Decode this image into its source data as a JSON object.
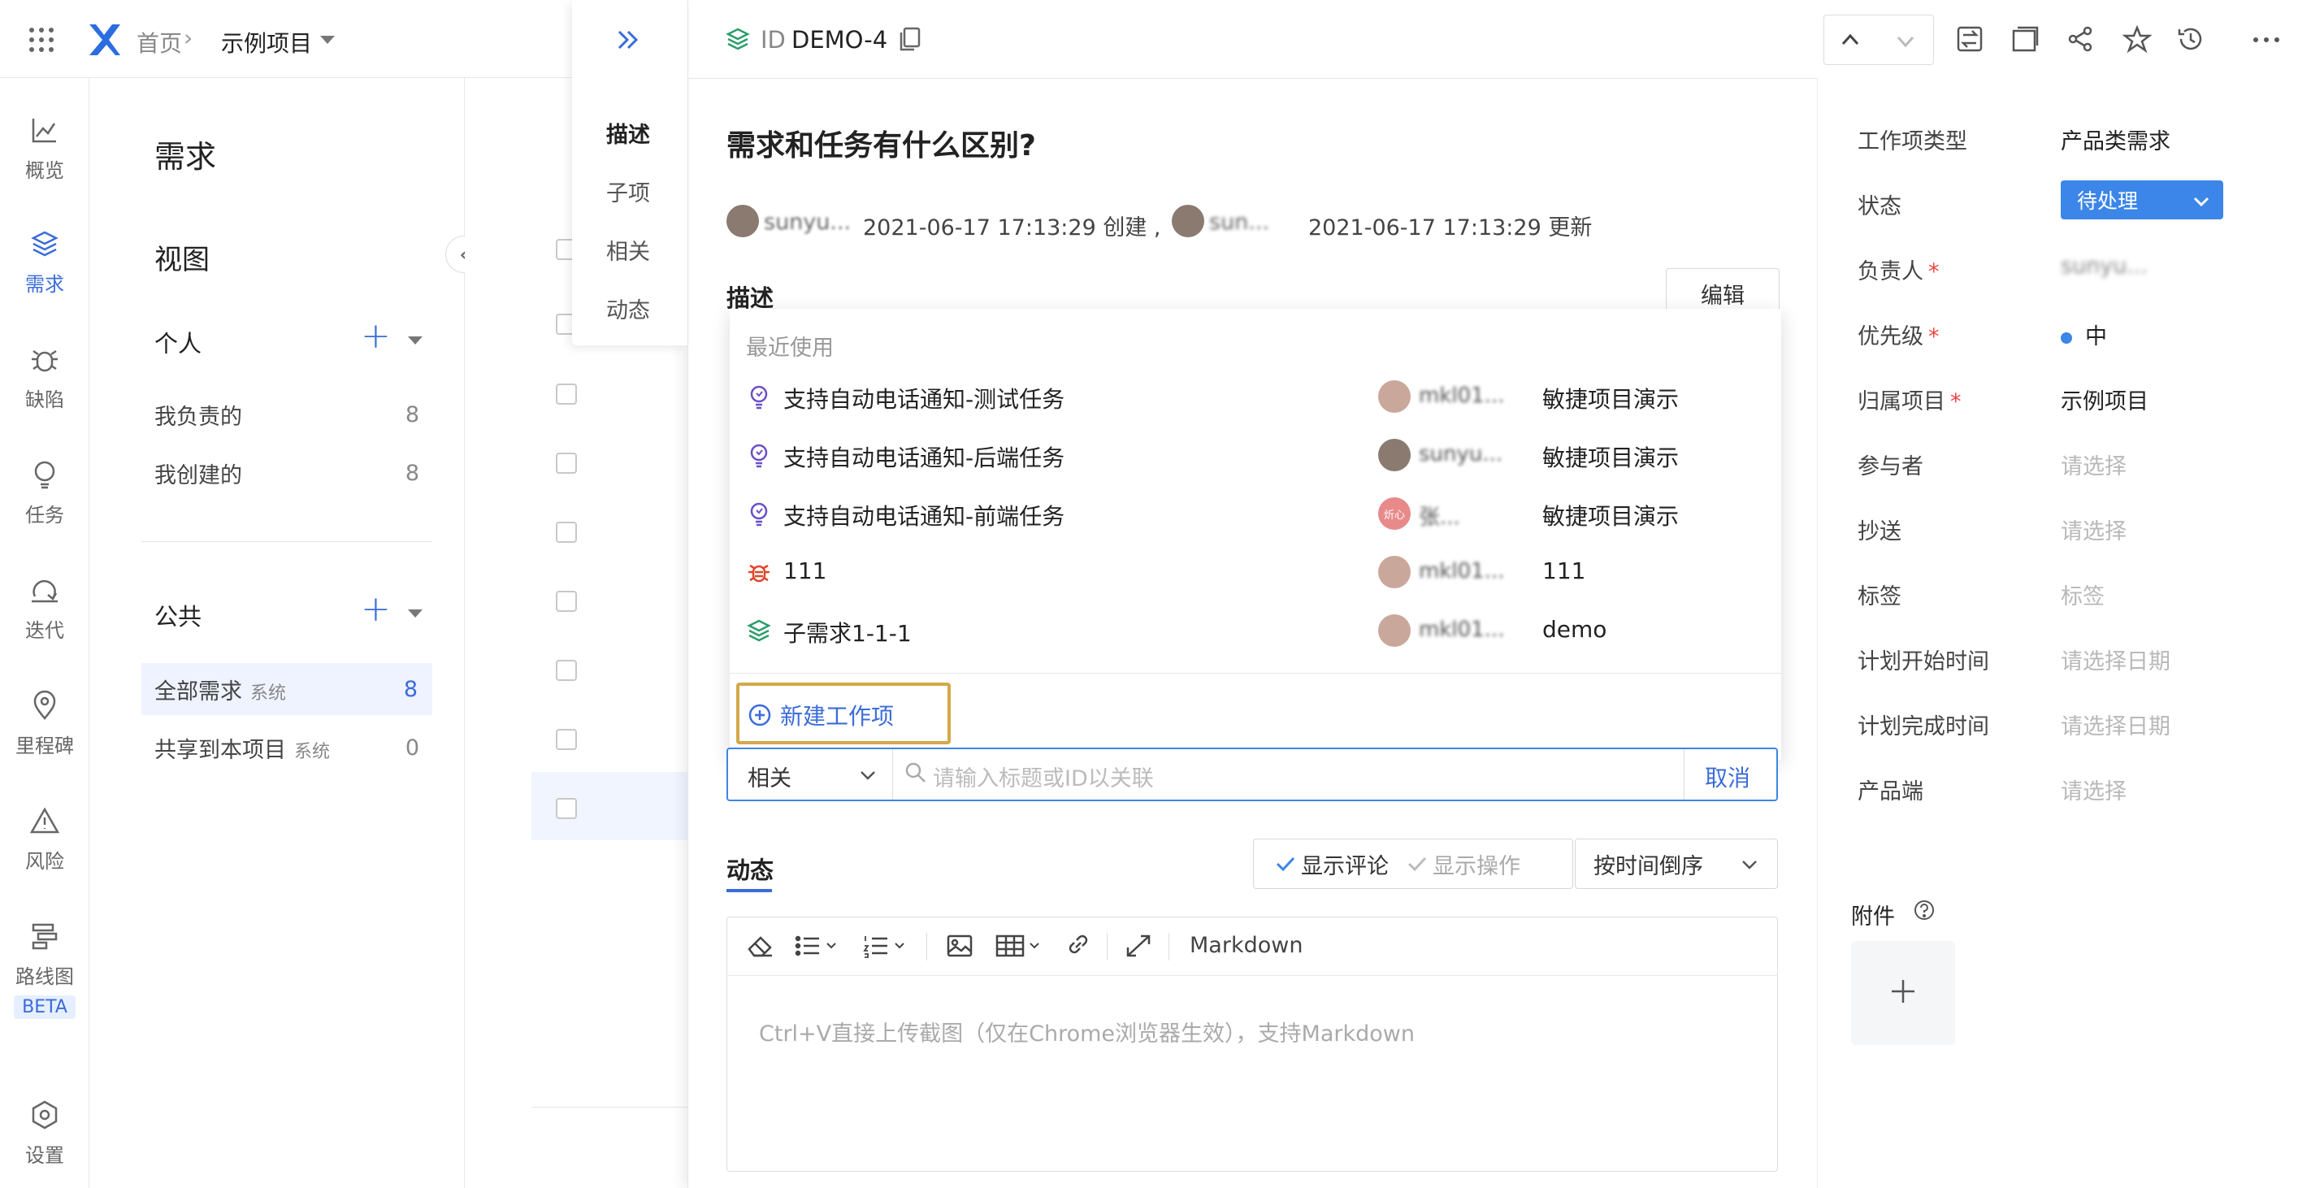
{
  "topbar": {
    "breadcrumb_home": "首页",
    "breadcrumb_project": "示例项目"
  },
  "leftnav": [
    {
      "label": "概览",
      "icon": "overview-icon"
    },
    {
      "label": "需求",
      "icon": "requirement-icon"
    },
    {
      "label": "缺陷",
      "icon": "bug-icon"
    },
    {
      "label": "任务",
      "icon": "task-icon"
    },
    {
      "label": "迭代",
      "icon": "iteration-icon"
    },
    {
      "label": "里程碑",
      "icon": "milestone-icon"
    },
    {
      "label": "风险",
      "icon": "risk-icon"
    },
    {
      "label": "路线图",
      "icon": "roadmap-icon",
      "badge": "BETA"
    },
    {
      "label": "设置",
      "icon": "settings-icon"
    }
  ],
  "panel2": {
    "title": "需求",
    "views_heading": "视图",
    "personal": {
      "heading": "个人",
      "items": [
        {
          "label": "我负责的",
          "count": "8"
        },
        {
          "label": "我创建的",
          "count": "8"
        }
      ]
    },
    "public": {
      "heading": "公共",
      "items": [
        {
          "label": "全部需求",
          "tag": "系统",
          "count": "8"
        },
        {
          "label": "共享到本项目",
          "tag": "系统",
          "count": "0"
        }
      ]
    }
  },
  "sidetabs": [
    "描述",
    "子项",
    "相关",
    "动态"
  ],
  "detail": {
    "id_label": "ID",
    "id_value": "DEMO-4",
    "title": "需求和任务有什么区别?",
    "creator": "sunyu...",
    "created": "2021-06-17 17:13:29 创建 ,",
    "updater": "sun...",
    "updated": "2021-06-17 17:13:29 更新",
    "desc_heading": "描述",
    "edit_button": "编辑",
    "relation_select": "相关",
    "relation_placeholder": "请输入标题或ID以关联",
    "cancel": "取消",
    "activity_heading": "动态",
    "show_comments": "显示评论",
    "show_ops": "显示操作",
    "sort": "按时间倒序",
    "toolbar_markdown": "Markdown",
    "editor_placeholder": "Ctrl+V直接上传截图（仅在Chrome浏览器生效），支持Markdown"
  },
  "dropdown": {
    "recent_heading": "最近使用",
    "items": [
      {
        "title": "支持自动电话通知-测试任务",
        "user": "mkl01...",
        "project": "敏捷项目演示",
        "type": "task",
        "avatar": "#c9a79a"
      },
      {
        "title": "支持自动电话通知-后端任务",
        "user": "sunyu...",
        "project": "敏捷项目演示",
        "type": "task",
        "avatar": "#8a7a70"
      },
      {
        "title": "支持自动电话通知-前端任务",
        "user": "张...",
        "project": "敏捷项目演示",
        "type": "task",
        "avatar": "#e88a8a",
        "avatar_text": "炘心"
      },
      {
        "title": "111",
        "user": "mkl01...",
        "project": "111",
        "type": "bug",
        "avatar": "#c9a79a"
      },
      {
        "title": "子需求1-1-1",
        "user": "mkl01...",
        "project": "demo",
        "type": "requirement",
        "avatar": "#c9a79a"
      }
    ],
    "new_item": "新建工作项"
  },
  "meta": [
    {
      "label": "工作项类型",
      "value": "产品类需求"
    },
    {
      "label": "状态",
      "value": "待处理",
      "kind": "status"
    },
    {
      "label": "负责人",
      "required": true,
      "value": "sunyu...",
      "kind": "blur"
    },
    {
      "label": "优先级",
      "required": true,
      "value": "中",
      "kind": "priority"
    },
    {
      "label": "归属项目",
      "required": true,
      "value": "示例项目"
    },
    {
      "label": "参与者",
      "value": "请选择",
      "placeholder": true
    },
    {
      "label": "抄送",
      "value": "请选择",
      "placeholder": true
    },
    {
      "label": "标签",
      "value": "标签",
      "placeholder": true
    },
    {
      "label": "计划开始时间",
      "value": "请选择日期",
      "placeholder": true
    },
    {
      "label": "计划完成时间",
      "value": "请选择日期",
      "placeholder": true
    },
    {
      "label": "产品端",
      "value": "请选择",
      "placeholder": true
    }
  ],
  "attachments_label": "附件",
  "colors": {
    "accent": "#3b6cd9",
    "status_bg": "#3b86e8",
    "highlight_border": "#d4a84a"
  }
}
